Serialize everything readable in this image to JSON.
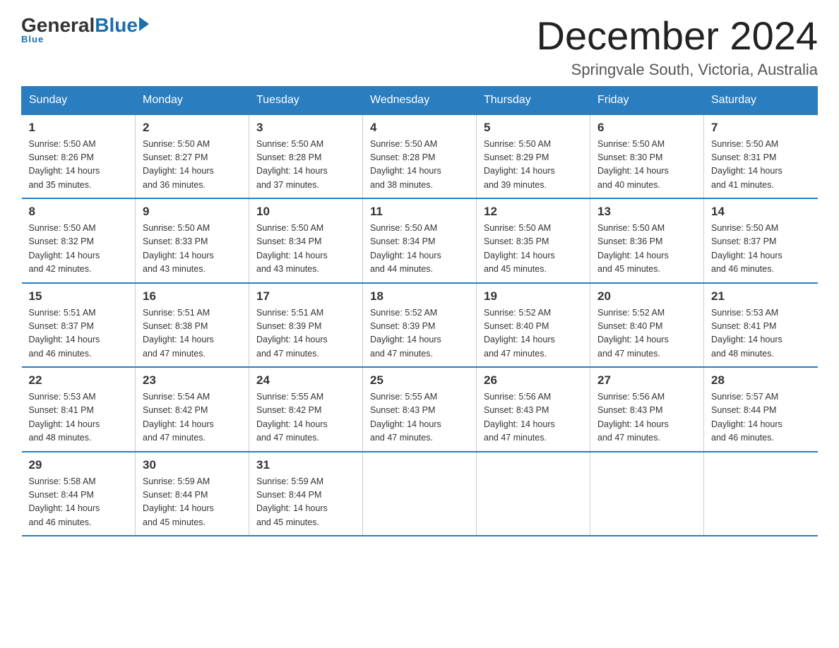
{
  "header": {
    "logo_general": "General",
    "logo_blue": "Blue",
    "month_title": "December 2024",
    "location": "Springvale South, Victoria, Australia"
  },
  "weekdays": [
    "Sunday",
    "Monday",
    "Tuesday",
    "Wednesday",
    "Thursday",
    "Friday",
    "Saturday"
  ],
  "weeks": [
    [
      {
        "day": "1",
        "sunrise": "5:50 AM",
        "sunset": "8:26 PM",
        "daylight": "14 hours and 35 minutes."
      },
      {
        "day": "2",
        "sunrise": "5:50 AM",
        "sunset": "8:27 PM",
        "daylight": "14 hours and 36 minutes."
      },
      {
        "day": "3",
        "sunrise": "5:50 AM",
        "sunset": "8:28 PM",
        "daylight": "14 hours and 37 minutes."
      },
      {
        "day": "4",
        "sunrise": "5:50 AM",
        "sunset": "8:28 PM",
        "daylight": "14 hours and 38 minutes."
      },
      {
        "day": "5",
        "sunrise": "5:50 AM",
        "sunset": "8:29 PM",
        "daylight": "14 hours and 39 minutes."
      },
      {
        "day": "6",
        "sunrise": "5:50 AM",
        "sunset": "8:30 PM",
        "daylight": "14 hours and 40 minutes."
      },
      {
        "day": "7",
        "sunrise": "5:50 AM",
        "sunset": "8:31 PM",
        "daylight": "14 hours and 41 minutes."
      }
    ],
    [
      {
        "day": "8",
        "sunrise": "5:50 AM",
        "sunset": "8:32 PM",
        "daylight": "14 hours and 42 minutes."
      },
      {
        "day": "9",
        "sunrise": "5:50 AM",
        "sunset": "8:33 PM",
        "daylight": "14 hours and 43 minutes."
      },
      {
        "day": "10",
        "sunrise": "5:50 AM",
        "sunset": "8:34 PM",
        "daylight": "14 hours and 43 minutes."
      },
      {
        "day": "11",
        "sunrise": "5:50 AM",
        "sunset": "8:34 PM",
        "daylight": "14 hours and 44 minutes."
      },
      {
        "day": "12",
        "sunrise": "5:50 AM",
        "sunset": "8:35 PM",
        "daylight": "14 hours and 45 minutes."
      },
      {
        "day": "13",
        "sunrise": "5:50 AM",
        "sunset": "8:36 PM",
        "daylight": "14 hours and 45 minutes."
      },
      {
        "day": "14",
        "sunrise": "5:50 AM",
        "sunset": "8:37 PM",
        "daylight": "14 hours and 46 minutes."
      }
    ],
    [
      {
        "day": "15",
        "sunrise": "5:51 AM",
        "sunset": "8:37 PM",
        "daylight": "14 hours and 46 minutes."
      },
      {
        "day": "16",
        "sunrise": "5:51 AM",
        "sunset": "8:38 PM",
        "daylight": "14 hours and 47 minutes."
      },
      {
        "day": "17",
        "sunrise": "5:51 AM",
        "sunset": "8:39 PM",
        "daylight": "14 hours and 47 minutes."
      },
      {
        "day": "18",
        "sunrise": "5:52 AM",
        "sunset": "8:39 PM",
        "daylight": "14 hours and 47 minutes."
      },
      {
        "day": "19",
        "sunrise": "5:52 AM",
        "sunset": "8:40 PM",
        "daylight": "14 hours and 47 minutes."
      },
      {
        "day": "20",
        "sunrise": "5:52 AM",
        "sunset": "8:40 PM",
        "daylight": "14 hours and 47 minutes."
      },
      {
        "day": "21",
        "sunrise": "5:53 AM",
        "sunset": "8:41 PM",
        "daylight": "14 hours and 48 minutes."
      }
    ],
    [
      {
        "day": "22",
        "sunrise": "5:53 AM",
        "sunset": "8:41 PM",
        "daylight": "14 hours and 48 minutes."
      },
      {
        "day": "23",
        "sunrise": "5:54 AM",
        "sunset": "8:42 PM",
        "daylight": "14 hours and 47 minutes."
      },
      {
        "day": "24",
        "sunrise": "5:55 AM",
        "sunset": "8:42 PM",
        "daylight": "14 hours and 47 minutes."
      },
      {
        "day": "25",
        "sunrise": "5:55 AM",
        "sunset": "8:43 PM",
        "daylight": "14 hours and 47 minutes."
      },
      {
        "day": "26",
        "sunrise": "5:56 AM",
        "sunset": "8:43 PM",
        "daylight": "14 hours and 47 minutes."
      },
      {
        "day": "27",
        "sunrise": "5:56 AM",
        "sunset": "8:43 PM",
        "daylight": "14 hours and 47 minutes."
      },
      {
        "day": "28",
        "sunrise": "5:57 AM",
        "sunset": "8:44 PM",
        "daylight": "14 hours and 46 minutes."
      }
    ],
    [
      {
        "day": "29",
        "sunrise": "5:58 AM",
        "sunset": "8:44 PM",
        "daylight": "14 hours and 46 minutes."
      },
      {
        "day": "30",
        "sunrise": "5:59 AM",
        "sunset": "8:44 PM",
        "daylight": "14 hours and 45 minutes."
      },
      {
        "day": "31",
        "sunrise": "5:59 AM",
        "sunset": "8:44 PM",
        "daylight": "14 hours and 45 minutes."
      },
      null,
      null,
      null,
      null
    ]
  ],
  "labels": {
    "sunrise": "Sunrise:",
    "sunset": "Sunset:",
    "daylight": "Daylight:"
  }
}
